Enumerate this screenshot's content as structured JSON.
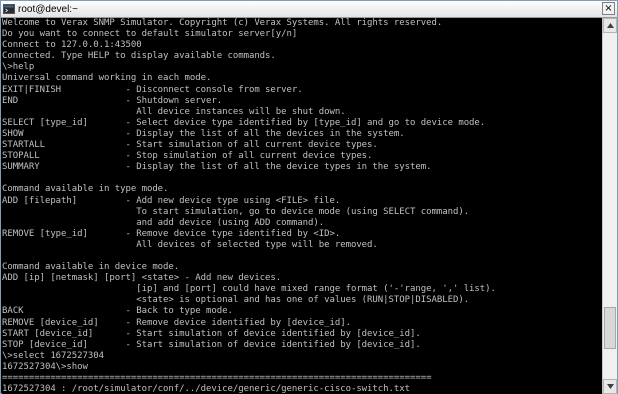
{
  "window": {
    "title": "root@devel:~",
    "close_glyph": "×"
  },
  "scrollbar": {
    "position_fraction": 0.9,
    "visible_fraction": 0.12
  },
  "console": {
    "lines": [
      "Welcome to Verax SNMP Simulator. Copyright (c) Verax Systems. All rights reserved.",
      "Do you want to connect to default simulator server[y/n]",
      "Connect to 127.0.0.1:43500",
      "Connected. Type HELP to display available commands.",
      "\\>help",
      "Universal command working in each mode.",
      "EXIT|FINISH            - Disconnect console from server.",
      "END                    - Shutdown server.",
      "                         All device instances will be shut down.",
      "SELECT [type_id]       - Select device type identified by [type_id] and go to device mode.",
      "SHOW                   - Display the list of all the devices in the system.",
      "STARTALL               - Start simulation of all current device types.",
      "STOPALL                - Stop simulation of all current device types.",
      "SUMMARY                - Display the list of all the device types in the system.",
      "",
      "Command available in type mode.",
      "ADD [filepath]         - Add new device type using <FILE> file.",
      "                         To start simulation, go to device mode (using SELECT command).",
      "                         and add device (using ADD command).",
      "REMOVE [type_id]       - Remove device type identified by <ID>.",
      "                         All devices of selected type will be removed.",
      "",
      "Command available in device mode.",
      "ADD [ip] [netmask] [port] <state> - Add new devices.",
      "                         [ip] and [port] could have mixed range format ('-'range, ',' list).",
      "                         <state> is optional and has one of values (RUN|STOP|DISABLED).",
      "BACK                   - Back to type mode.",
      "REMOVE [device_id]     - Remove device identified by [device_id].",
      "START [device_id]      - Start simulation of device identified by [device_id].",
      "STOP [device_id]       - Start simulation of device identified by [device_id].",
      "\\>select 1672527304",
      "1672527304\\>show",
      "================================================================================",
      "1672527304 : /root/simulator/conf/../device/generic/generic-cisco-switch.txt"
    ]
  }
}
